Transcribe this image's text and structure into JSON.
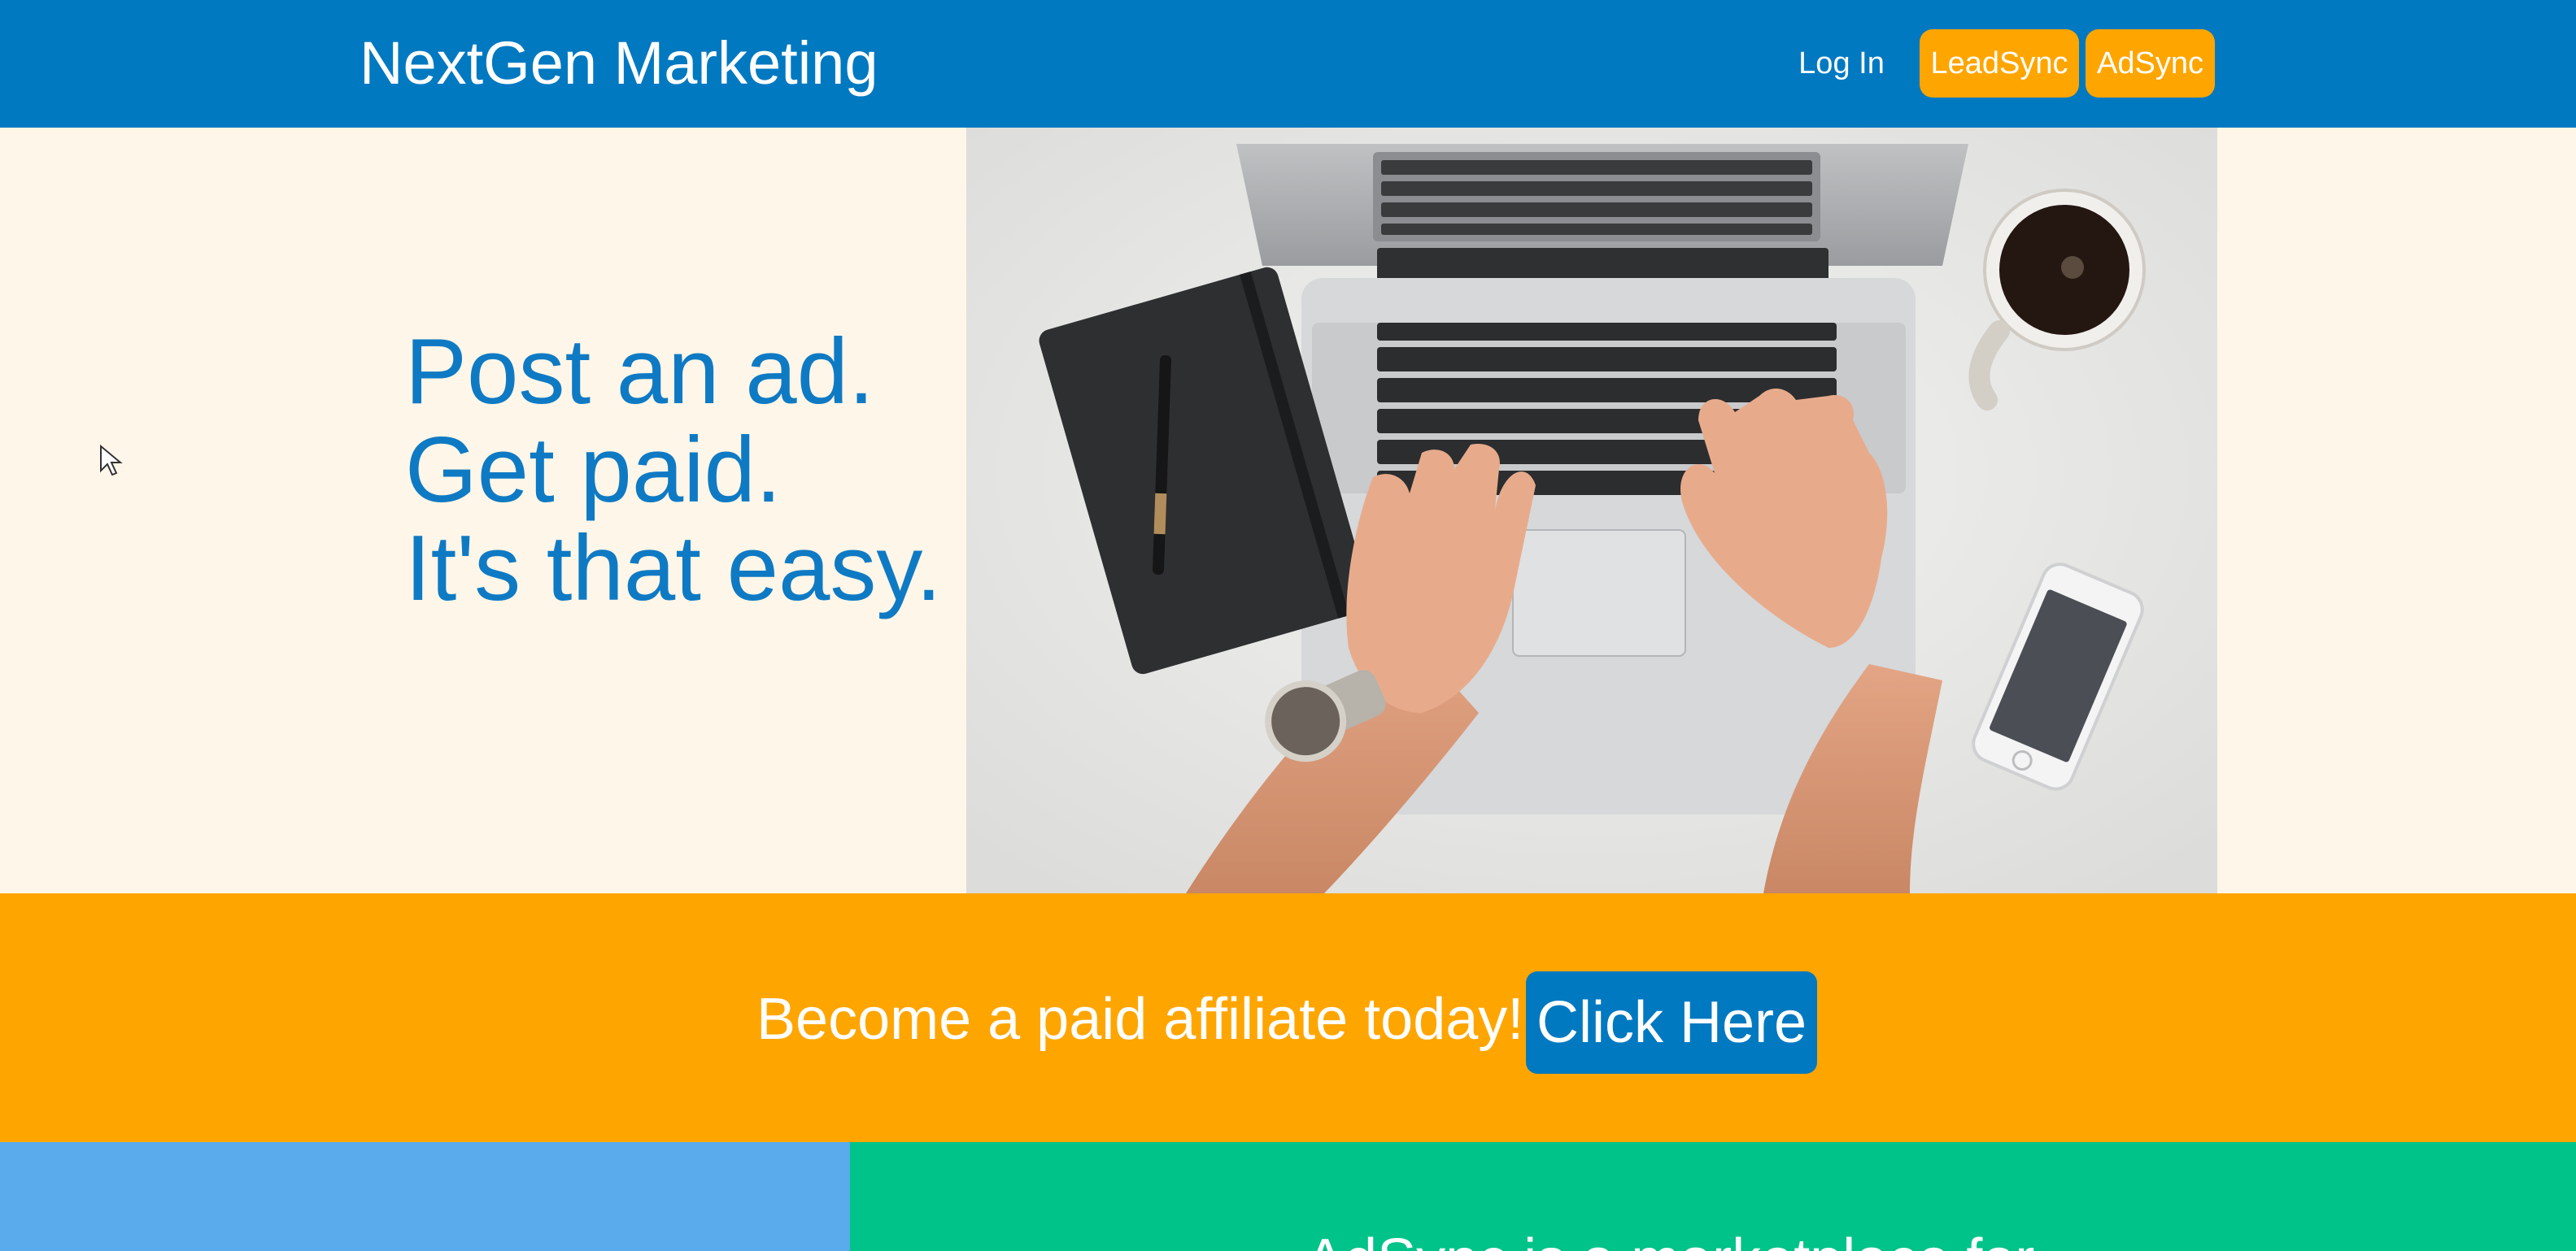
{
  "header": {
    "brand": "NextGen Marketing",
    "login_label": "Log In",
    "leadsync_label": "LeadSync",
    "adsync_label": "AdSync"
  },
  "hero": {
    "lines": [
      "Post an ad.",
      "Get paid.",
      "It's that easy."
    ],
    "image": "laptop-workspace-photo"
  },
  "cta": {
    "text": "Become a paid affiliate today!",
    "button_label": "Click Here"
  },
  "panels": {
    "right_text": "AdSync is a marketplace for"
  },
  "colors": {
    "header_bg": "#0079c1",
    "accent_orange": "#ffa500",
    "hero_bg": "#fef6e8",
    "hero_text": "#0f7ac4",
    "panel_left_bg": "#5aabec",
    "panel_right_bg": "#00c389"
  },
  "icons": {
    "cursor": "mouse-pointer-icon"
  }
}
